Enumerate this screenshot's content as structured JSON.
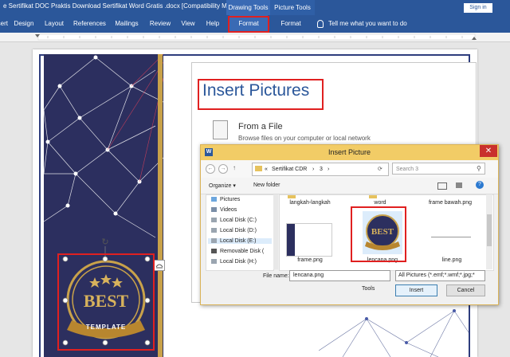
{
  "titlebar": {
    "document_title": "e Sertifikat DOC Praktis Download Sertifikat Word Gratis .docx [Compatibility Mode]...",
    "drawing_tools": "Drawing Tools",
    "picture_tools": "Picture Tools",
    "sign_in": "Sign in"
  },
  "ribbon": {
    "tabs": [
      "Insert",
      "Design",
      "Layout",
      "References",
      "Mailings",
      "Review",
      "View",
      "Help",
      "Format",
      "Format"
    ],
    "tell_me": "Tell me what you want to do"
  },
  "certificate": {
    "badge_text": "BEST",
    "ribbon_text": "TEMPLATE"
  },
  "insert_pictures": {
    "title": "Insert Pictures",
    "from_file_title": "From a File",
    "from_file_desc": "Browse files on your computer or local network"
  },
  "dialog": {
    "title": "Insert Picture",
    "app_icon": "W",
    "breadcrumb": [
      "«",
      "Sertifikat CDR",
      "›",
      "3",
      "›"
    ],
    "search_placeholder": "Search 3",
    "organize": "Organize ▾",
    "new_folder": "New folder",
    "nav_items": [
      "Pictures",
      "Videos",
      "Local Disk (C:)",
      "Local Disk (D:)",
      "Local Disk (E:)",
      "Removable Disk (",
      "Local Disk (H:)"
    ],
    "files": [
      "langkah-langkah",
      "word",
      "frame bawah.png",
      "frame.png",
      "lencana.png",
      "line.png"
    ],
    "file_name_label": "File name:",
    "file_name_value": "lencana.png",
    "filter_value": "All Pictures (*.emf;*.wmf;*.jpg;*",
    "tools_label": "Tools",
    "insert_label": "Insert",
    "cancel_label": "Cancel",
    "close_glyph": "✕"
  },
  "colors": {
    "word_blue": "#2b579a",
    "cert_navy": "#2c2f5f",
    "gold": "#c9a24a",
    "highlight_red": "#e02020",
    "dialog_title_yellow": "#f2cc66"
  },
  "icons": [
    "lightbulb-icon",
    "rotate-handle-icon",
    "layout-options-icon",
    "word-app-icon",
    "back-arrow-icon",
    "forward-arrow-icon",
    "up-arrow-icon",
    "folder-icon",
    "refresh-icon",
    "search-icon",
    "view-icon",
    "help-icon"
  ]
}
